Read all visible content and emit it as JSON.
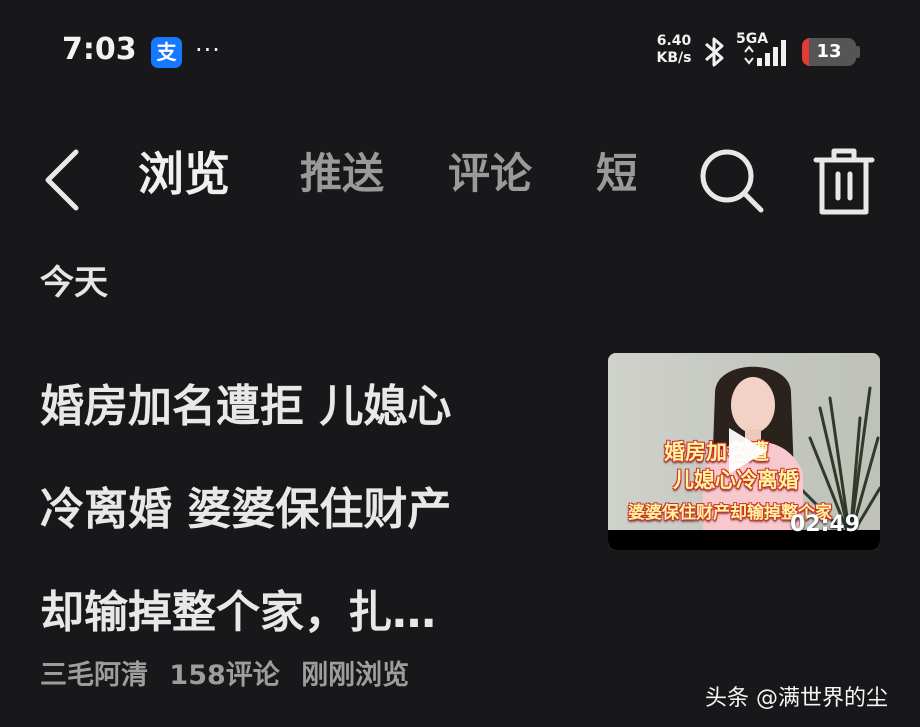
{
  "status_bar": {
    "time": "7:03",
    "app_icon_char": "支",
    "more": "···",
    "net_speed_value": "6.40",
    "net_speed_unit": "KB/s",
    "network_label": "5GA",
    "battery": "13",
    "battery_level_percent": 13,
    "battery_color": "#e53935"
  },
  "nav": {
    "back_icon": "chevron-left-icon",
    "tabs": [
      {
        "label": "浏览",
        "active": true
      },
      {
        "label": "推送",
        "active": false
      },
      {
        "label": "评论",
        "active": false
      },
      {
        "label": "短",
        "active": false
      }
    ],
    "search_icon": "search-icon",
    "delete_icon": "trash-icon"
  },
  "section_title": "今天",
  "item": {
    "title_lines": [
      "婚房加名遭拒 儿媳心",
      "冷离婚 婆婆保住财产",
      "却输掉整个家，扎…"
    ],
    "thumbnail": {
      "caption_line1": "婚房加名遭",
      "caption_line2": "儿媳心冷离婚",
      "caption_line3": "婆婆保住财产却输掉整个家",
      "duration": "02:49",
      "play_icon": "play-icon"
    },
    "author": "三毛阿清",
    "comments": "158评论",
    "viewed": "刚刚浏览"
  },
  "watermark": "头条 @满世界的尘"
}
